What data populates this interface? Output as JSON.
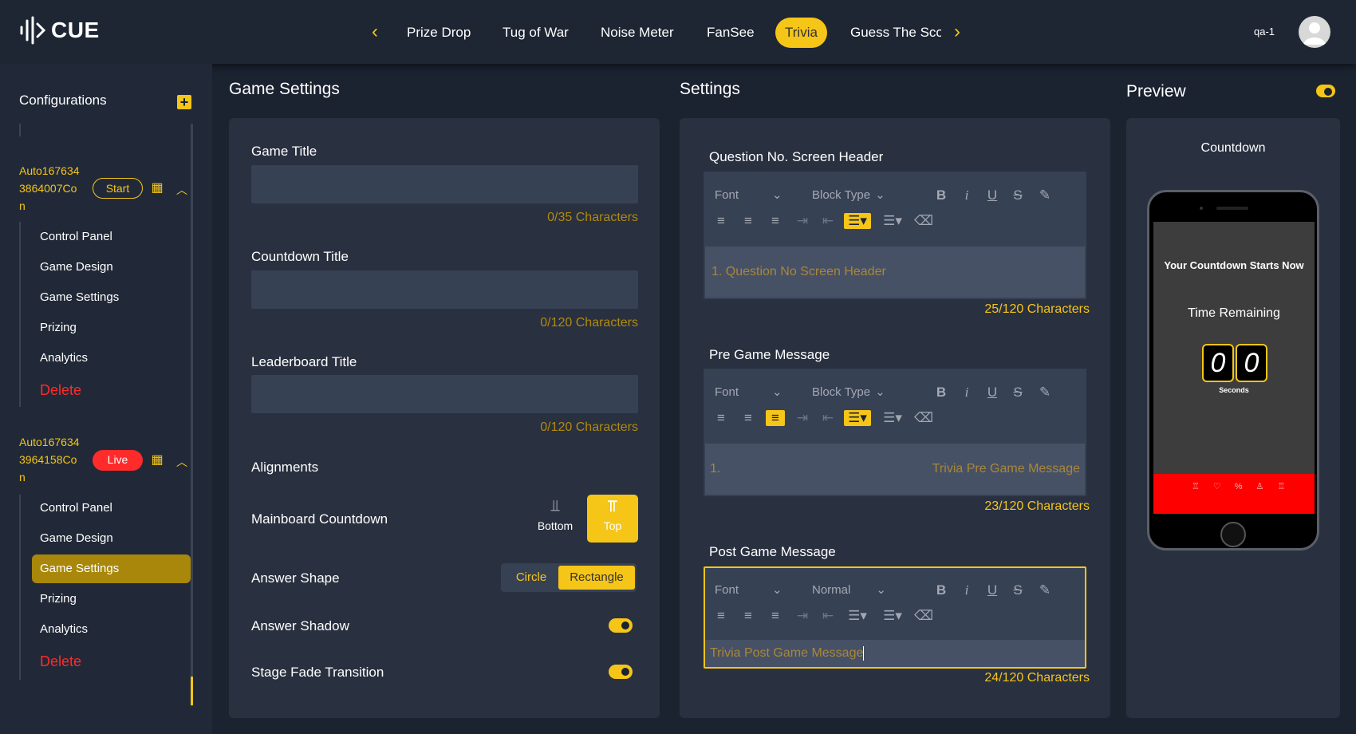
{
  "app": {
    "name": "CUE"
  },
  "nav": {
    "tabs": [
      {
        "label": "Prize Drop"
      },
      {
        "label": "Tug of War"
      },
      {
        "label": "Noise Meter"
      },
      {
        "label": "FanSee"
      },
      {
        "label": "Trivia"
      },
      {
        "label": "Guess The Sco"
      }
    ],
    "active": "Trivia"
  },
  "user": {
    "name": "qa-1"
  },
  "sidebar": {
    "title": "Configurations",
    "configs": [
      {
        "name_lines": [
          "Auto167634",
          "3864007Co",
          "n"
        ],
        "status": "Start",
        "items": [
          "Control Panel",
          "Game Design",
          "Game Settings",
          "Prizing",
          "Analytics"
        ],
        "delete": "Delete"
      },
      {
        "name_lines": [
          "Auto167634",
          "3964158Co",
          "n"
        ],
        "status": "Live",
        "items": [
          "Control Panel",
          "Game Design",
          "Game Settings",
          "Prizing",
          "Analytics"
        ],
        "delete": "Delete",
        "selected": "Game Settings"
      }
    ]
  },
  "game_settings": {
    "title": "Game Settings",
    "game_title": {
      "label": "Game Title",
      "value": "",
      "count": "0/35 Characters"
    },
    "countdown_title": {
      "label": "Countdown Title",
      "value": "",
      "count": "0/120 Characters"
    },
    "leaderboard_title": {
      "label": "Leaderboard Title",
      "value": "",
      "count": "0/120 Characters"
    },
    "alignments": "Alignments",
    "mainboard": {
      "label": "Mainboard Countdown",
      "bottom": "Bottom",
      "top": "Top",
      "selected": "Top"
    },
    "answer_shape": {
      "label": "Answer Shape",
      "circle": "Circle",
      "rectangle": "Rectangle",
      "selected": "Rectangle"
    },
    "answer_shadow": {
      "label": "Answer Shadow",
      "on": true
    },
    "stage_fade": {
      "label": "Stage Fade Transition",
      "on": true
    }
  },
  "settings": {
    "title": "Settings",
    "editors": [
      {
        "label": "Question No. Screen Header",
        "font": "Font",
        "block": "Block Type",
        "placeholder": "1.  Question No Screen Header",
        "count": "25/120 Characters"
      },
      {
        "label": "Pre Game Message",
        "font": "Font",
        "block": "Block Type",
        "num": "1.",
        "placeholder": "Trivia Pre Game Message",
        "count": "23/120 Characters"
      },
      {
        "label": "Post Game Message",
        "font": "Font",
        "block": "Normal",
        "value": "Trivia Post Game Message",
        "count": "24/120 Characters"
      }
    ]
  },
  "preview": {
    "title": "Preview",
    "enabled": true,
    "panel_title": "Countdown",
    "starts": "Your Countdown Starts Now",
    "remaining": "Time Remaining",
    "digits": [
      "0",
      "0"
    ],
    "unit": "Seconds"
  },
  "colors": {
    "accent": "#f5c518",
    "live": "#ff2b2b",
    "bg": "#1b2230"
  }
}
